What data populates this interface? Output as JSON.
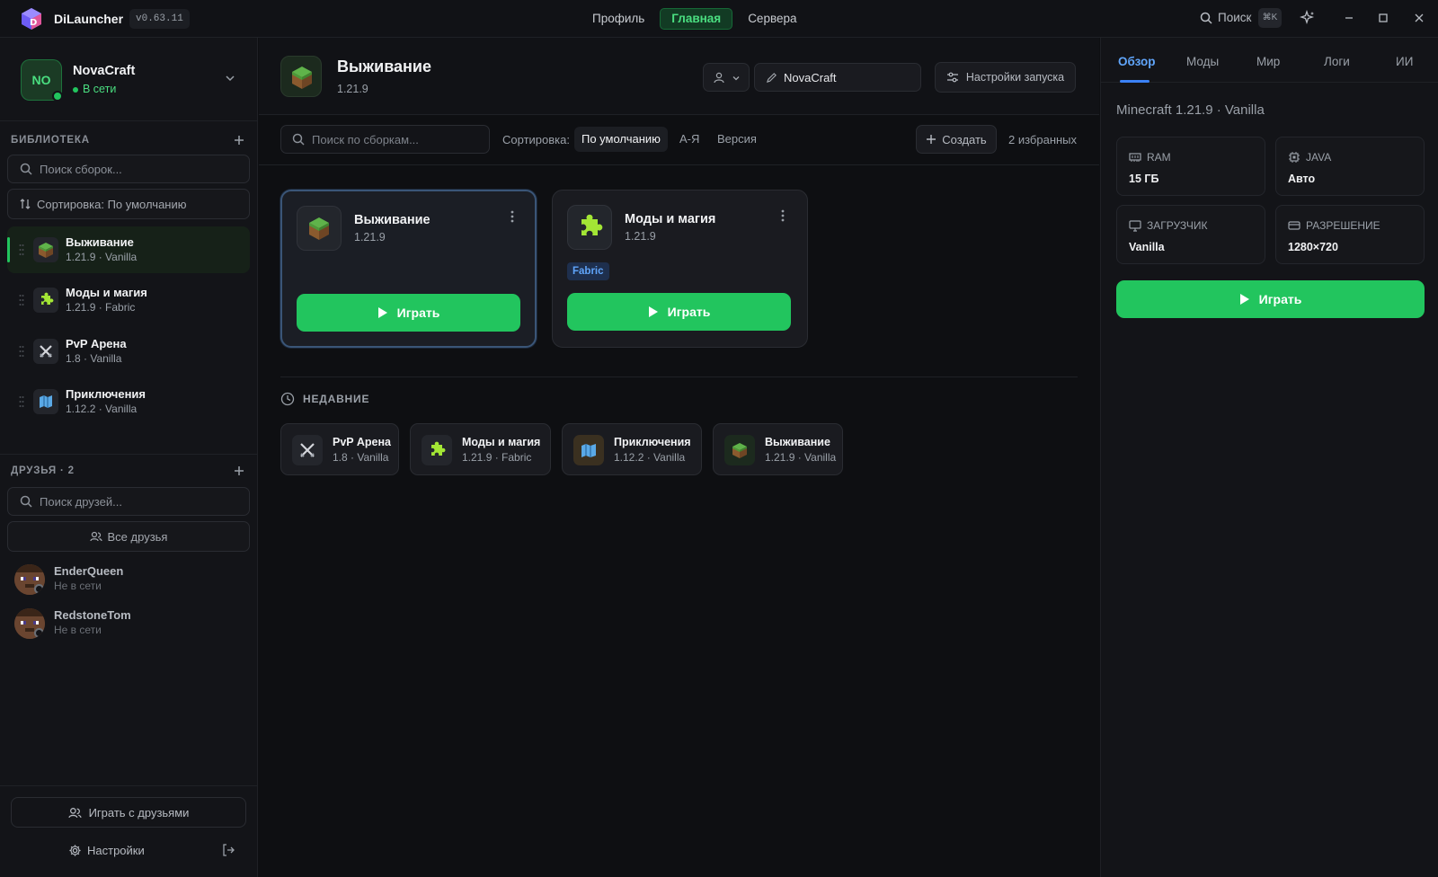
{
  "app": {
    "name": "DiLauncher",
    "version": "v0.63.11"
  },
  "topnav": [
    {
      "label": "Профиль",
      "active": false
    },
    {
      "label": "Главная",
      "active": true
    },
    {
      "label": "Сервера",
      "active": false
    }
  ],
  "search": {
    "label": "Поиск",
    "shortcut": "⌘K"
  },
  "profile": {
    "initials": "NO",
    "name": "NovaCraft",
    "status": "В сети"
  },
  "library": {
    "heading": "БИБЛИОТЕКА",
    "search_placeholder": "Поиск сборок...",
    "sort_label": "Сортировка: По умолчанию",
    "items": [
      {
        "title": "Выживание",
        "subtitle": "1.21.9 · Vanilla",
        "icon": "grass-block-icon",
        "active": true
      },
      {
        "title": "Моды и магия",
        "subtitle": "1.21.9 · Fabric",
        "icon": "puzzle-icon",
        "active": false
      },
      {
        "title": "PvP Арена",
        "subtitle": "1.8 · Vanilla",
        "icon": "crossed-swords-icon",
        "active": false
      },
      {
        "title": "Приключения",
        "subtitle": "1.12.2 · Vanilla",
        "icon": "map-icon",
        "active": false
      }
    ]
  },
  "friends": {
    "heading": "ДРУЗЬЯ · 2",
    "search_placeholder": "Поиск друзей...",
    "all_label": "Все друзья",
    "items": [
      {
        "name": "EnderQueen",
        "status": "Не в сети"
      },
      {
        "name": "RedstoneTom",
        "status": "Не в сети"
      }
    ]
  },
  "sidebar_bottom": {
    "play_with_friends": "Играть с друзьями",
    "settings": "Настройки"
  },
  "main": {
    "title": "Выживание",
    "version": "1.21.9",
    "nickname": "NovaCraft",
    "launch_settings": "Настройки запуска",
    "search_placeholder": "Поиск по сборкам...",
    "sort_label": "Сортировка:",
    "sort_options": [
      {
        "label": "По умолчанию",
        "active": true
      },
      {
        "label": "А-Я",
        "active": false
      },
      {
        "label": "Версия",
        "active": false
      }
    ],
    "create_label": "Создать",
    "favorites_count": "2 избранных",
    "cards": [
      {
        "title": "Выживание",
        "version": "1.21.9",
        "tag": "",
        "play": "Играть",
        "selected": true
      },
      {
        "title": "Моды и магия",
        "version": "1.21.9",
        "tag": "Fabric",
        "play": "Играть",
        "selected": false
      }
    ],
    "recent_heading": "НЕДАВНИЕ",
    "recent": [
      {
        "title": "PvP Арена",
        "subtitle": "1.8 · Vanilla"
      },
      {
        "title": "Моды и магия",
        "subtitle": "1.21.9 · Fabric"
      },
      {
        "title": "Приключения",
        "subtitle": "1.12.2 · Vanilla"
      },
      {
        "title": "Выживание",
        "subtitle": "1.21.9 · Vanilla"
      }
    ]
  },
  "right": {
    "tabs": [
      {
        "label": "Обзор",
        "active": true
      },
      {
        "label": "Моды",
        "active": false
      },
      {
        "label": "Мир",
        "active": false
      },
      {
        "label": "Логи",
        "active": false
      },
      {
        "label": "ИИ",
        "active": false
      }
    ],
    "meta": "Minecraft 1.21.9 · Vanilla",
    "stats": [
      {
        "label": "RAM",
        "value": "15 ГБ",
        "icon": "memory-icon"
      },
      {
        "label": "JAVA",
        "value": "Авто",
        "icon": "cpu-icon"
      },
      {
        "label": "ЗАГРУЗЧИК",
        "value": "Vanilla",
        "icon": "monitor-icon"
      },
      {
        "label": "РАЗРЕШЕНИЕ",
        "value": "1280×720",
        "icon": "display-icon"
      }
    ],
    "play": "Играть"
  },
  "colors": {
    "accent": "#22c55e",
    "tab_accent": "#3b82f6",
    "background": "#0e0f12",
    "panel": "#131418"
  }
}
